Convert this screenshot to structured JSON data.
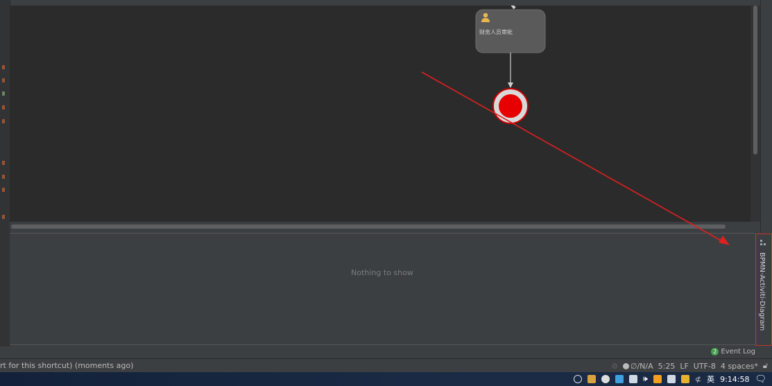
{
  "diagram": {
    "task_label": "财务人员审批",
    "task_icon": "user-icon"
  },
  "panel": {
    "empty_text": "Nothing to show"
  },
  "side_tab": {
    "label": "BPMN-Activiti-Diagram",
    "icon": "diagram-icon"
  },
  "event_log": {
    "badge_count": "2",
    "label": "Event Log"
  },
  "status": {
    "message": "rt for this shortcut) (moments ago)",
    "vcs": "∅/N/A",
    "position": "5:25",
    "line_sep": "LF",
    "encoding": "UTF-8",
    "indent": "4 spaces*"
  },
  "taskbar": {
    "ime": "英",
    "time": "9:14:58"
  },
  "colors": {
    "end_event": "#e60000",
    "arrow": "#e02020",
    "canvas": "#2b2b2b",
    "node": "#5a5a5a"
  }
}
